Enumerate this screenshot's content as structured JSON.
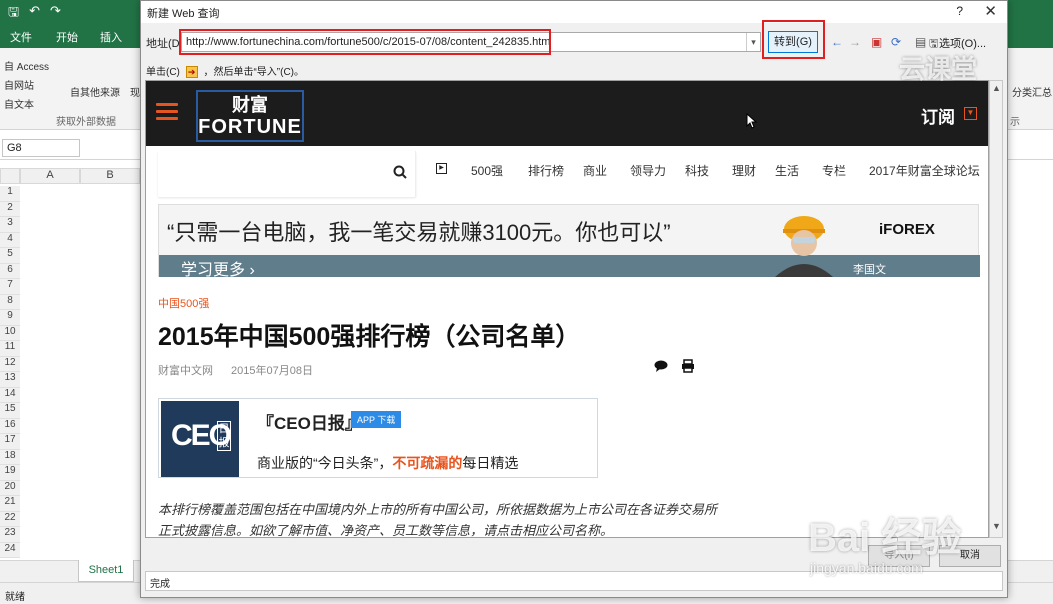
{
  "excel": {
    "tabs": [
      "文件",
      "开始",
      "插入"
    ],
    "ribbon": {
      "access": "自 Access",
      "website": "自网站",
      "text": "自文本",
      "other_sources": "自其他来源",
      "existing": "现",
      "group_label": "获取外部数据",
      "sort_label": "分类汇总",
      "right_group": "示"
    },
    "name_box": "G8",
    "columns": [
      "A",
      "B"
    ],
    "rows": [
      "1",
      "2",
      "3",
      "4",
      "5",
      "6",
      "7",
      "8",
      "9",
      "10",
      "11",
      "12",
      "13",
      "14",
      "15",
      "16",
      "17",
      "18",
      "19",
      "20",
      "21",
      "22",
      "23",
      "24"
    ],
    "sheet_tab": "Sheet1",
    "status": "就绪"
  },
  "dialog": {
    "title": "新建 Web 查询",
    "help": "?",
    "close": "✕",
    "address_label": "地址(D):",
    "address_value": "http://www.fortunechina.com/fortune500/c/2015-07/08/content_242835.htm",
    "go_button": "转到(G)",
    "options_button": "选项(O)...",
    "hint_prefix": "单击(C)",
    "hint_suffix": "，然后单击“导入”(C)。",
    "import_button": "导入(I)",
    "cancel_button": "取消",
    "status": "完成"
  },
  "site": {
    "logo_cn": "财富",
    "logo_en": "FORTUNE",
    "subscribe": "订阅",
    "nav": [
      "500强",
      "排行榜",
      "商业",
      "领导力",
      "科技",
      "理财",
      "生活",
      "专栏",
      "2017年财富全球论坛"
    ],
    "ad": {
      "headline": "“只需一台电脑，我一笔交易就赚3100元。你也可以”",
      "cta": "学习更多 ›",
      "brand": "iFOREX",
      "person": "李国文"
    },
    "category": "中国500强",
    "article_title": "2015年中国500强排行榜（公司名单）",
    "source": "财富中文网",
    "date": "2015年07月08日",
    "ceo_logo": "CEO",
    "ceo_logo_sub": "日报",
    "ceo_title": "『CEO日报』",
    "app_badge": "APP 下载",
    "ceo_line_a": "商业版的“今日头条”，",
    "ceo_line_b": "不可疏漏的",
    "ceo_line_c": "每日精选",
    "description": "本排行榜覆盖范围包括在中国境内外上市的所有中国公司，所依据数据为上市公司在各证券交易所正式披露信息。如欲了解市值、净资产、员工数等信息，请点击相应公司名称。"
  },
  "watermarks": {
    "top": "云课堂",
    "baidu": "Bai 经验",
    "url": "jingyan.baidu.com"
  }
}
